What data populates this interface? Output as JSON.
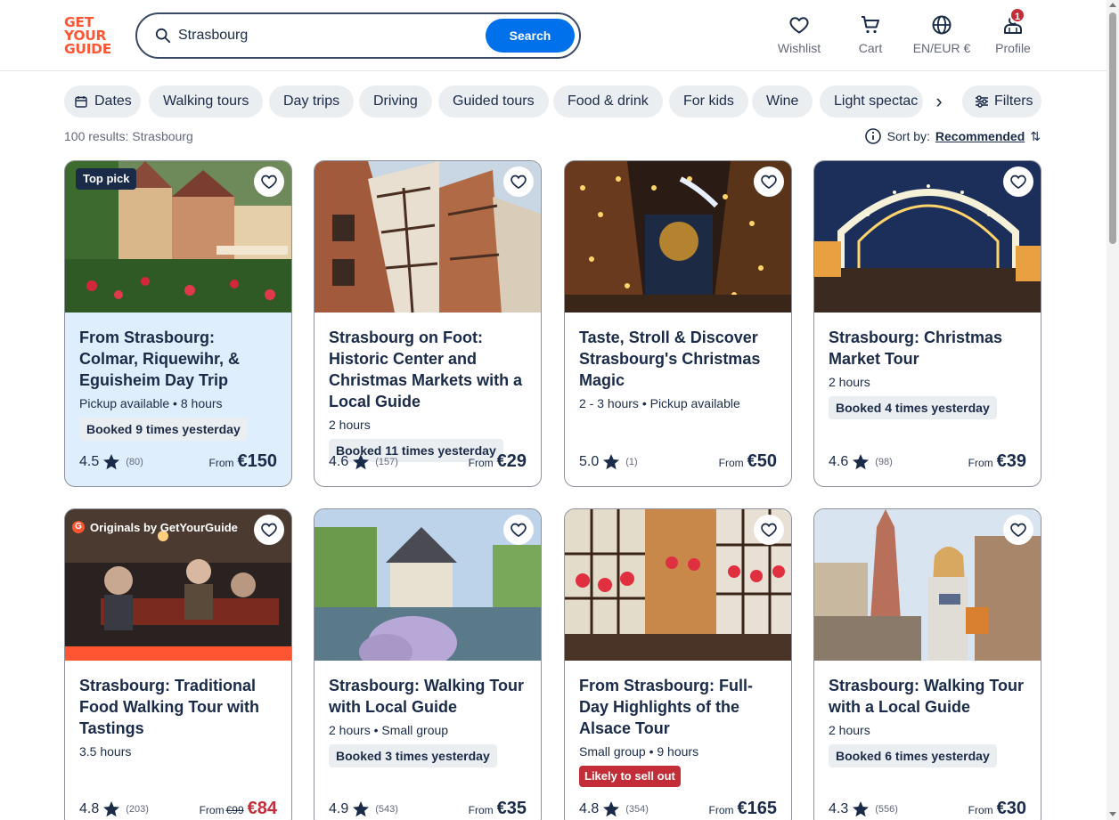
{
  "brand": {
    "logo_lines": [
      "GET",
      "YOUR",
      "GUIDE"
    ],
    "accent": "#ff5533",
    "primary": "#0071eb",
    "navy": "#1a2b49",
    "alert": "#c22d37"
  },
  "search": {
    "value": "Strasbourg",
    "button_label": "Search"
  },
  "nav": {
    "wishlist": "Wishlist",
    "cart": "Cart",
    "language": "EN/EUR €",
    "profile": "Profile",
    "profile_badge": "1"
  },
  "chips": [
    "Dates",
    "Walking tours",
    "Day trips",
    "Driving",
    "Guided tours",
    "Food & drink",
    "For kids",
    "Wine",
    "Light spectac"
  ],
  "filters_label": "Filters",
  "results_text": "100 results: Strasbourg",
  "sort": {
    "label": "Sort by:",
    "value": "Recommended"
  },
  "cards": [
    {
      "badge": "Top pick",
      "title": "From Strasbourg: Colmar, Riquewihr, & Eguisheim Day Trip",
      "meta": "Pickup available • 8 hours",
      "booked": "Booked 9 times yesterday",
      "rating": "4.5",
      "reviews": "(80)",
      "from": "From",
      "price": "€150"
    },
    {
      "title": "Strasbourg on Foot: Historic Center and Christmas Markets with a Local Guide",
      "meta": "2 hours",
      "booked": "Booked 11 times yesterday",
      "rating": "4.6",
      "reviews": "(157)",
      "from": "From",
      "price": "€29"
    },
    {
      "title": "Taste, Stroll & Discover Strasbourg's Christmas Magic",
      "meta": "2 - 3 hours • Pickup available",
      "rating": "5.0",
      "reviews": "(1)",
      "from": "From",
      "price": "€50"
    },
    {
      "title": "Strasbourg: Christmas Market Tour",
      "meta": "2 hours",
      "booked": "Booked 4 times yesterday",
      "rating": "4.6",
      "reviews": "(98)",
      "from": "From",
      "price": "€39"
    },
    {
      "originals": "Originals by GetYourGuide",
      "title": "Strasbourg: Traditional Food Walking Tour with Tastings",
      "meta": "3.5 hours",
      "rating": "4.8",
      "reviews": "(203)",
      "from": "From",
      "old_price": "€99",
      "price": "€84"
    },
    {
      "title": "Strasbourg: Walking Tour with Local Guide",
      "meta": "2 hours • Small group",
      "booked": "Booked 3 times yesterday",
      "rating": "4.9",
      "reviews": "(543)",
      "from": "From",
      "price": "€35"
    },
    {
      "title": "From Strasbourg: Full-Day Highlights of the Alsace Tour",
      "meta": "Small group • 9 hours",
      "selling": "Likely to sell out",
      "rating": "4.8",
      "reviews": "(354)",
      "from": "From",
      "price": "€165"
    },
    {
      "title": "Strasbourg: Walking Tour with a Local Guide",
      "meta": "2 hours",
      "booked": "Booked 6 times yesterday",
      "rating": "4.3",
      "reviews": "(556)",
      "from": "From",
      "price": "€30"
    }
  ]
}
